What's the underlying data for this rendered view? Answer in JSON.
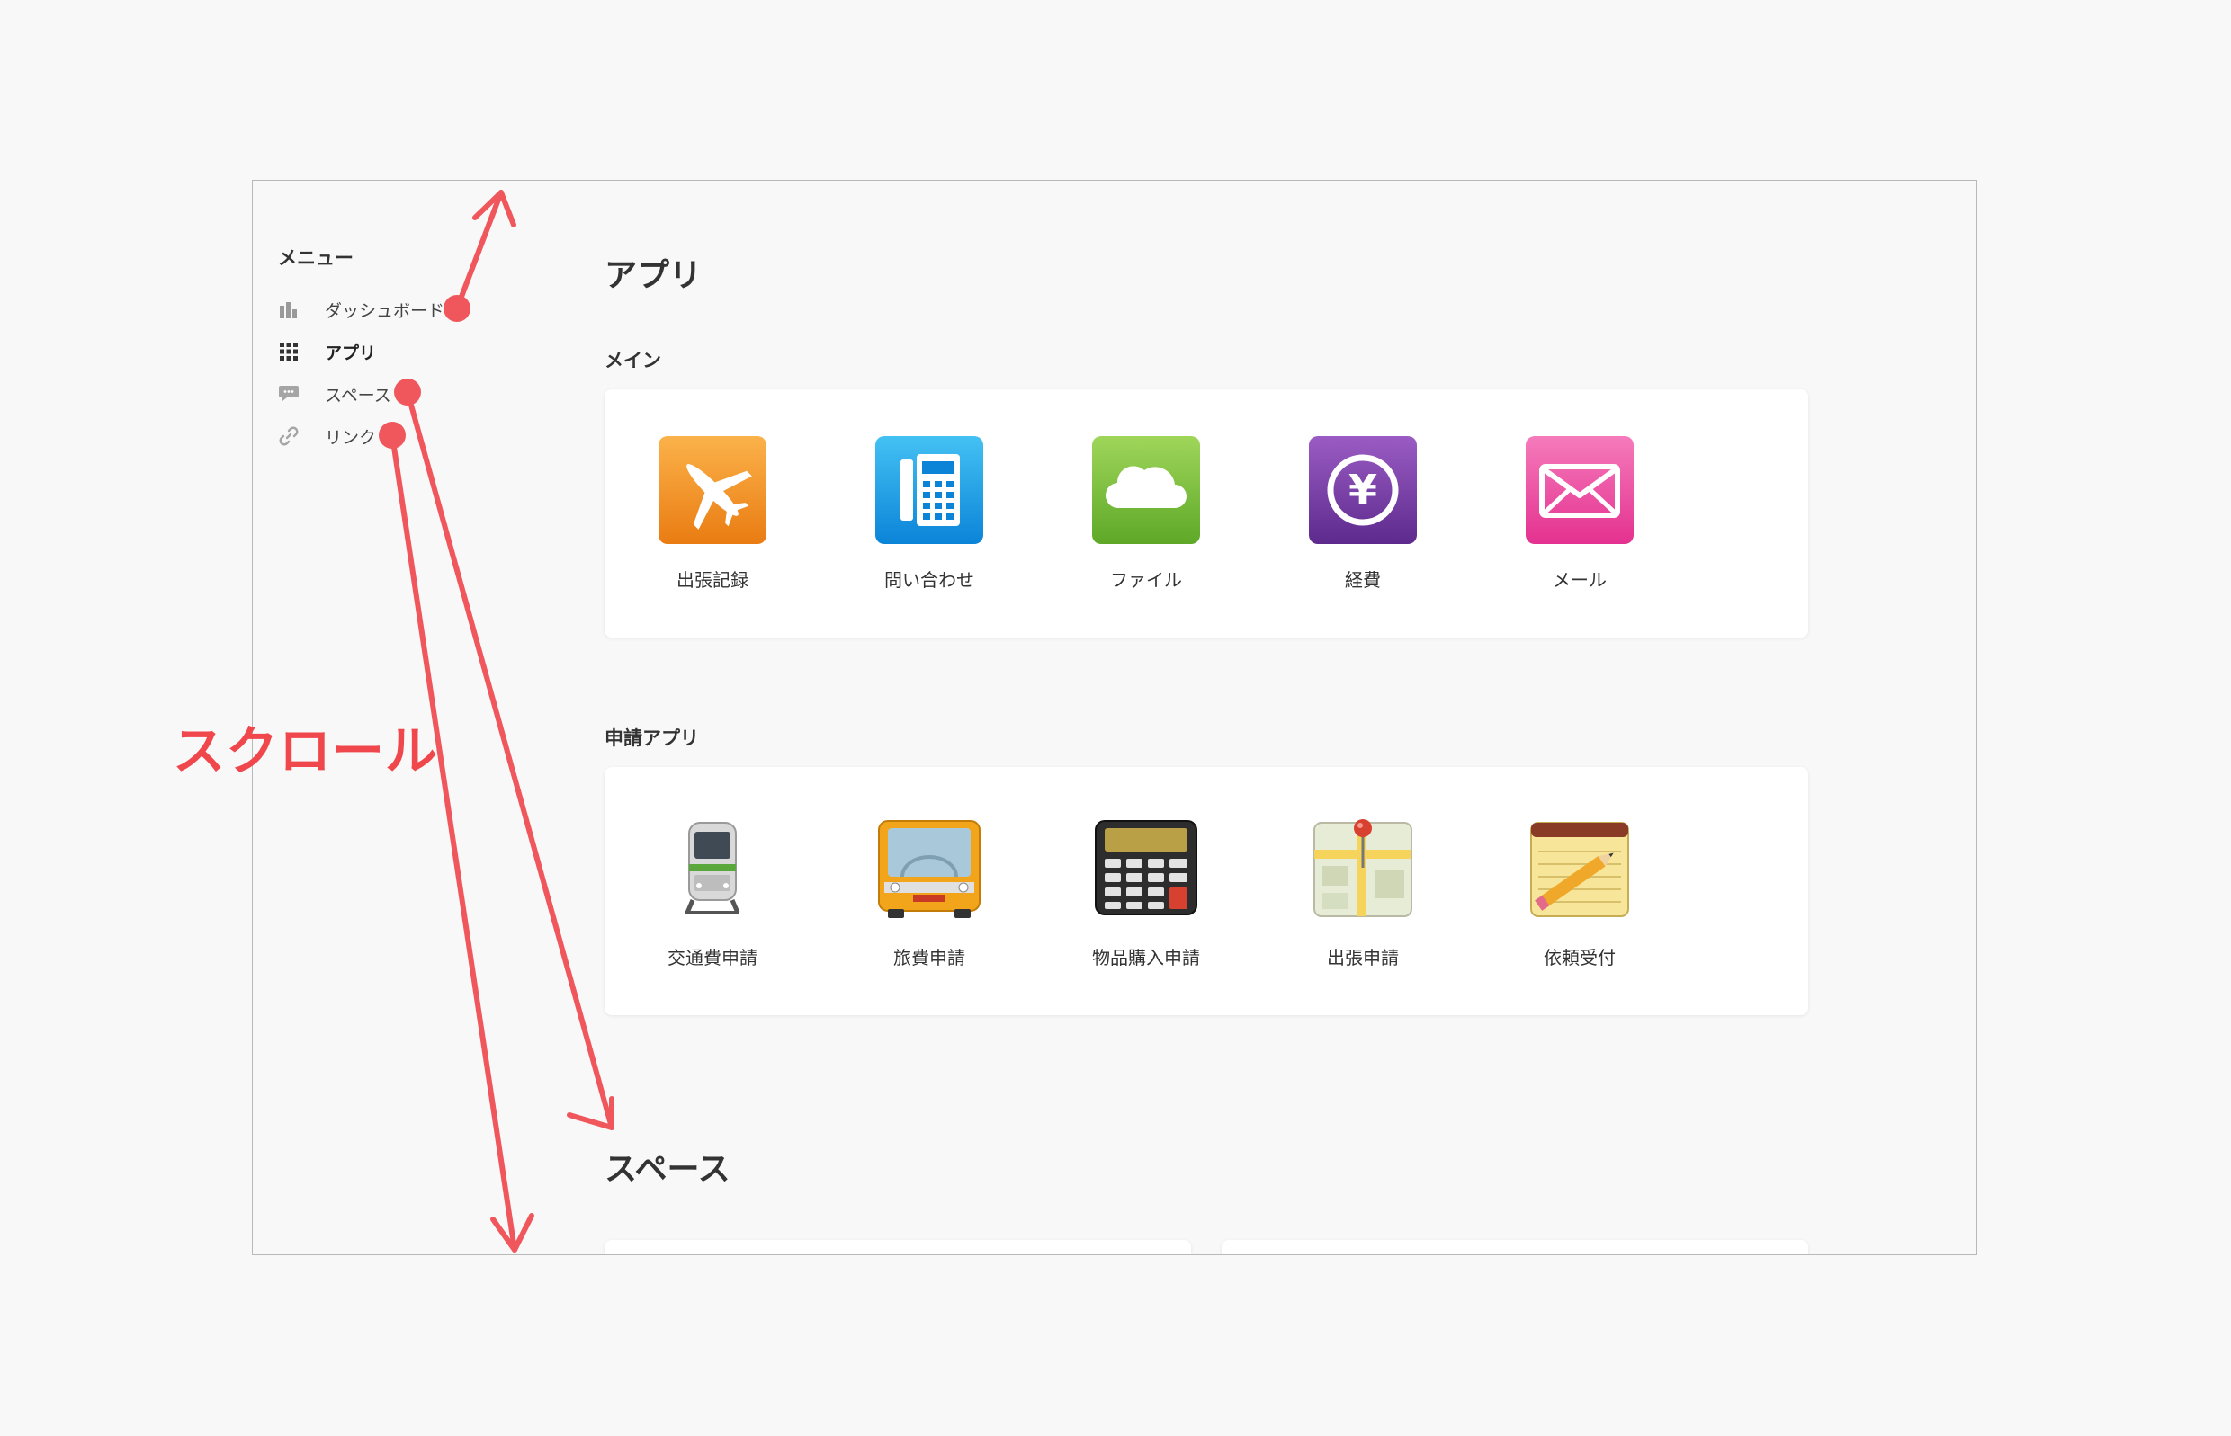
{
  "sidebar": {
    "heading": "メニュー",
    "items": [
      {
        "label": "ダッシュボード",
        "icon": "bar-chart-icon"
      },
      {
        "label": "アプリ",
        "icon": "grid-icon",
        "active": true
      },
      {
        "label": "スペース",
        "icon": "chat-bubble-icon"
      },
      {
        "label": "リンク",
        "icon": "link-icon"
      }
    ]
  },
  "main": {
    "title": "アプリ",
    "sections": [
      {
        "label": "メイン",
        "apps": [
          {
            "label": "出張記録",
            "icon": "airplane-icon"
          },
          {
            "label": "問い合わせ",
            "icon": "phone-icon"
          },
          {
            "label": "ファイル",
            "icon": "cloud-icon"
          },
          {
            "label": "経費",
            "icon": "yen-icon"
          },
          {
            "label": "メール",
            "icon": "mail-icon"
          }
        ]
      },
      {
        "label": "申請アプリ",
        "apps": [
          {
            "label": "交通費申請",
            "icon": "train-icon"
          },
          {
            "label": "旅費申請",
            "icon": "bus-icon"
          },
          {
            "label": "物品購入申請",
            "icon": "calculator-icon"
          },
          {
            "label": "出張申請",
            "icon": "map-pin-icon"
          },
          {
            "label": "依頼受付",
            "icon": "notepad-pencil-icon"
          }
        ]
      }
    ],
    "spaces_title": "スペース"
  },
  "annotation": {
    "scroll_label": "スクロール",
    "color": "#f0474c"
  }
}
